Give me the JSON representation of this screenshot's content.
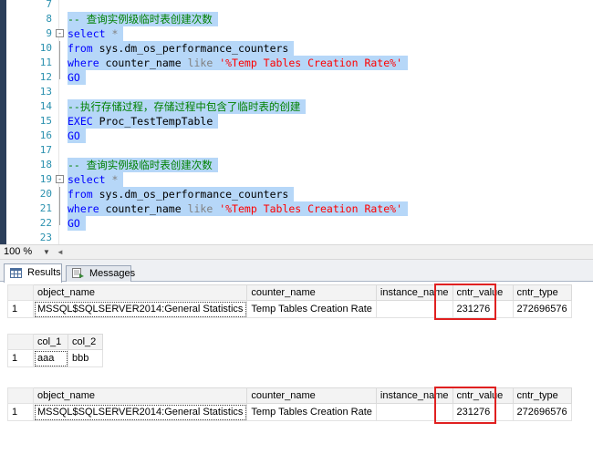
{
  "editor": {
    "lines": [
      {
        "num": "7",
        "segments": [],
        "selected": false
      },
      {
        "num": "8",
        "segments": [
          {
            "t": "-- 查询实例级临时表创建次数",
            "c": "cm"
          }
        ],
        "selected": true
      },
      {
        "num": "9",
        "fold": "-",
        "segments": [
          {
            "t": "select",
            "c": "kw"
          },
          {
            "t": " *",
            "c": "gr"
          }
        ],
        "selected": true
      },
      {
        "num": "10",
        "segments": [
          {
            "t": "from",
            "c": "kw"
          },
          {
            "t": " sys.dm_os_performance_counters",
            "c": "tx"
          }
        ],
        "selected": true
      },
      {
        "num": "11",
        "segments": [
          {
            "t": "where",
            "c": "kw"
          },
          {
            "t": " counter_name ",
            "c": "tx"
          },
          {
            "t": "like",
            "c": "gr"
          },
          {
            "t": " ",
            "c": "tx"
          },
          {
            "t": "'%Temp Tables Creation Rate%'",
            "c": "st"
          }
        ],
        "selected": true
      },
      {
        "num": "12",
        "segments": [
          {
            "t": "GO",
            "c": "kw"
          }
        ],
        "selected": true
      },
      {
        "num": "13",
        "segments": [],
        "selected": false
      },
      {
        "num": "14",
        "segments": [
          {
            "t": "--执行存储过程，存储过程中包含了临时表的创建",
            "c": "cm"
          }
        ],
        "selected": true
      },
      {
        "num": "15",
        "segments": [
          {
            "t": "EXEC",
            "c": "kw"
          },
          {
            "t": " Proc_TestTempTable",
            "c": "tx"
          }
        ],
        "selected": true
      },
      {
        "num": "16",
        "segments": [
          {
            "t": "GO",
            "c": "kw"
          }
        ],
        "selected": true
      },
      {
        "num": "17",
        "segments": [],
        "selected": false
      },
      {
        "num": "18",
        "segments": [
          {
            "t": "-- 查询实例级临时表创建次数",
            "c": "cm"
          }
        ],
        "selected": true
      },
      {
        "num": "19",
        "fold": "-",
        "segments": [
          {
            "t": "select",
            "c": "kw"
          },
          {
            "t": " *",
            "c": "gr"
          }
        ],
        "selected": true
      },
      {
        "num": "20",
        "segments": [
          {
            "t": "from",
            "c": "kw"
          },
          {
            "t": " sys.dm_os_performance_counters",
            "c": "tx"
          }
        ],
        "selected": true
      },
      {
        "num": "21",
        "segments": [
          {
            "t": "where",
            "c": "kw"
          },
          {
            "t": " counter_name ",
            "c": "tx"
          },
          {
            "t": "like",
            "c": "gr"
          },
          {
            "t": " ",
            "c": "tx"
          },
          {
            "t": "'%Temp Tables Creation Rate%'",
            "c": "st"
          }
        ],
        "selected": true
      },
      {
        "num": "22",
        "segments": [
          {
            "t": "GO",
            "c": "kw"
          }
        ],
        "selected": true
      },
      {
        "num": "23",
        "segments": [],
        "selected": false
      }
    ]
  },
  "zoom": {
    "level": "100 %",
    "dropdown_icon": "triangle-down",
    "scroll_icon": "triangle-left"
  },
  "tabs": {
    "results": "Results",
    "messages": "Messages"
  },
  "grid1": {
    "headers": [
      "object_name",
      "counter_name",
      "instance_name",
      "cntr_value",
      "cntr_type"
    ],
    "rows": [
      [
        "1",
        "MSSQL$SQLSERVER2014:General Statistics",
        "Temp Tables Creation Rate",
        "",
        "231276",
        "272696576"
      ]
    ]
  },
  "grid2": {
    "headers": [
      "col_1",
      "col_2"
    ],
    "rows": [
      [
        "1",
        "aaa",
        "bbb"
      ]
    ]
  },
  "grid3": {
    "headers": [
      "object_name",
      "counter_name",
      "instance_name",
      "cntr_value",
      "cntr_type"
    ],
    "rows": [
      [
        "1",
        "MSSQL$SQLSERVER2014:General Statistics",
        "Temp Tables Creation Rate",
        "",
        "231276",
        "272696576"
      ]
    ]
  },
  "colors": {
    "selection": "#b6d7f8",
    "highlight_border": "#e02020",
    "keyword": "#0000ff",
    "comment": "#008000",
    "string": "#ff0000"
  }
}
